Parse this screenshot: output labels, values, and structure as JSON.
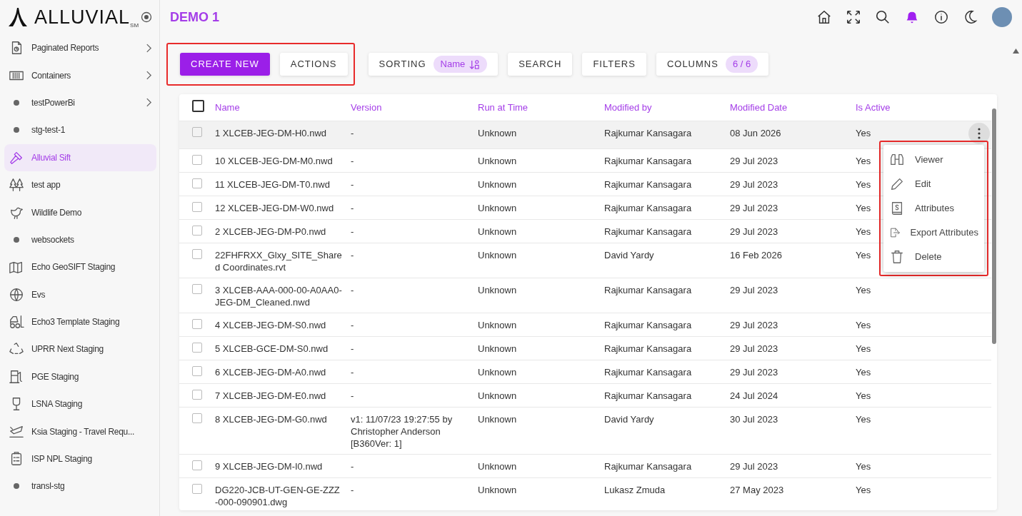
{
  "brand": {
    "name": "ALLUVIAL",
    "mark": "SM"
  },
  "sidebar": {
    "items": [
      {
        "label": "Paginated Reports",
        "kind": "icon",
        "selected": false,
        "expandable": true
      },
      {
        "label": "Containers",
        "kind": "icon",
        "selected": false,
        "expandable": true
      },
      {
        "label": "testPowerBi",
        "kind": "dot",
        "selected": false,
        "expandable": true
      },
      {
        "label": "stg-test-1",
        "kind": "dot",
        "selected": false,
        "expandable": false
      },
      {
        "label": "Alluvial Sift",
        "kind": "icon",
        "selected": true,
        "expandable": false
      },
      {
        "label": "test app",
        "kind": "icon",
        "selected": false,
        "expandable": false
      },
      {
        "label": "Wildlife Demo",
        "kind": "icon",
        "selected": false,
        "expandable": false
      },
      {
        "label": "websockets",
        "kind": "dot",
        "selected": false,
        "expandable": false
      },
      {
        "label": "Echo GeoSIFT Staging",
        "kind": "icon",
        "selected": false,
        "expandable": false
      },
      {
        "label": "Evs",
        "kind": "icon",
        "selected": false,
        "expandable": false
      },
      {
        "label": "Echo3 Template Staging",
        "kind": "icon",
        "selected": false,
        "expandable": false
      },
      {
        "label": "UPRR Next Staging",
        "kind": "icon",
        "selected": false,
        "expandable": false
      },
      {
        "label": "PGE Staging",
        "kind": "icon",
        "selected": false,
        "expandable": false
      },
      {
        "label": "LSNA Staging",
        "kind": "icon",
        "selected": false,
        "expandable": false
      },
      {
        "label": "Ksia Staging - Travel Requ...",
        "kind": "icon",
        "selected": false,
        "expandable": false
      },
      {
        "label": "ISP NPL Staging",
        "kind": "icon",
        "selected": false,
        "expandable": false
      },
      {
        "label": "transl-stg",
        "kind": "dot",
        "selected": false,
        "expandable": false
      }
    ]
  },
  "page_title": "DEMO 1",
  "toolbar": [
    {
      "highlighted": true,
      "buttons": [
        {
          "kind": "primary",
          "label": "CREATE NEW"
        },
        {
          "kind": "plain",
          "label": "ACTIONS"
        }
      ]
    },
    {
      "highlighted": false,
      "buttons": [
        {
          "kind": "pill",
          "label": "SORTING",
          "pill": "Name",
          "sort_icon": true
        },
        {
          "kind": "plain",
          "label": "SEARCH"
        },
        {
          "kind": "plain",
          "label": "FILTERS"
        },
        {
          "kind": "pill",
          "label": "COLUMNS",
          "pill": "6 / 6",
          "sort_icon": false
        }
      ]
    }
  ],
  "table": {
    "all_checked": false,
    "columns": [
      "Name",
      "Version",
      "Run at Time",
      "Modified by",
      "Modified Date",
      "Is Active"
    ],
    "rows": [
      {
        "checked": false,
        "hovered": true,
        "cells": [
          "1 XLCEB-JEG-DM-H0.nwd",
          "-",
          "Unknown",
          "Rajkumar Kansagara",
          "08 Jun 2026",
          "Yes"
        ]
      },
      {
        "checked": false,
        "hovered": false,
        "cells": [
          "10 XLCEB-JEG-DM-M0.nwd",
          "-",
          "Unknown",
          "Rajkumar Kansagara",
          "29 Jul 2023",
          "Yes"
        ]
      },
      {
        "checked": false,
        "hovered": false,
        "cells": [
          "11 XLCEB-JEG-DM-T0.nwd",
          "-",
          "Unknown",
          "Rajkumar Kansagara",
          "29 Jul 2023",
          "Yes"
        ]
      },
      {
        "checked": false,
        "hovered": false,
        "cells": [
          "12 XLCEB-JEG-DM-W0.nwd",
          "-",
          "Unknown",
          "Rajkumar Kansagara",
          "29 Jul 2023",
          "Yes"
        ]
      },
      {
        "checked": false,
        "hovered": false,
        "cells": [
          "2 XLCEB-JEG-DM-P0.nwd",
          "-",
          "Unknown",
          "Rajkumar Kansagara",
          "29 Jul 2023",
          "Yes"
        ]
      },
      {
        "checked": false,
        "hovered": false,
        "cells": [
          "22FHFRXX_Glxy_SITE_Shared Coordinates.rvt",
          "-",
          "Unknown",
          "David Yardy",
          "16 Feb 2026",
          "Yes"
        ]
      },
      {
        "checked": false,
        "hovered": false,
        "cells": [
          "3 XLCEB-AAA-000-00-A0AA0-JEG-DM_Cleaned.nwd",
          "-",
          "Unknown",
          "Rajkumar Kansagara",
          "29 Jul 2023",
          "Yes"
        ]
      },
      {
        "checked": false,
        "hovered": false,
        "cells": [
          "4 XLCEB-JEG-DM-S0.nwd",
          "-",
          "Unknown",
          "Rajkumar Kansagara",
          "29 Jul 2023",
          "Yes"
        ]
      },
      {
        "checked": false,
        "hovered": false,
        "cells": [
          "5 XLCEB-GCE-DM-S0.nwd",
          "-",
          "Unknown",
          "Rajkumar Kansagara",
          "29 Jul 2023",
          "Yes"
        ]
      },
      {
        "checked": false,
        "hovered": false,
        "cells": [
          "6 XLCEB-JEG-DM-A0.nwd",
          "-",
          "Unknown",
          "Rajkumar Kansagara",
          "29 Jul 2023",
          "Yes"
        ]
      },
      {
        "checked": false,
        "hovered": false,
        "cells": [
          "7 XLCEB-JEG-DM-E0.nwd",
          "-",
          "Unknown",
          "Rajkumar Kansagara",
          "24 Jul 2024",
          "Yes"
        ]
      },
      {
        "checked": false,
        "hovered": false,
        "cells": [
          "8 XLCEB-JEG-DM-G0.nwd",
          "v1: 11/07/23 19:27:55 by Christopher Anderson [B360Ver: 1]",
          "Unknown",
          "David Yardy",
          "30 Jul 2023",
          "Yes"
        ]
      },
      {
        "checked": false,
        "hovered": false,
        "cells": [
          "9 XLCEB-JEG-DM-I0.nwd",
          "-",
          "Unknown",
          "Rajkumar Kansagara",
          "29 Jul 2023",
          "Yes"
        ]
      },
      {
        "checked": false,
        "hovered": false,
        "cells": [
          "DG220-JCB-UT-GEN-GE-ZZZ-000-090901.dwg",
          "-",
          "Unknown",
          "Lukasz Zmuda",
          "27 May 2023",
          "Yes"
        ]
      }
    ]
  },
  "context_menu": {
    "highlighted": true,
    "items": [
      "Viewer",
      "Edit",
      "Attributes",
      "Export Attributes",
      "Delete"
    ]
  }
}
